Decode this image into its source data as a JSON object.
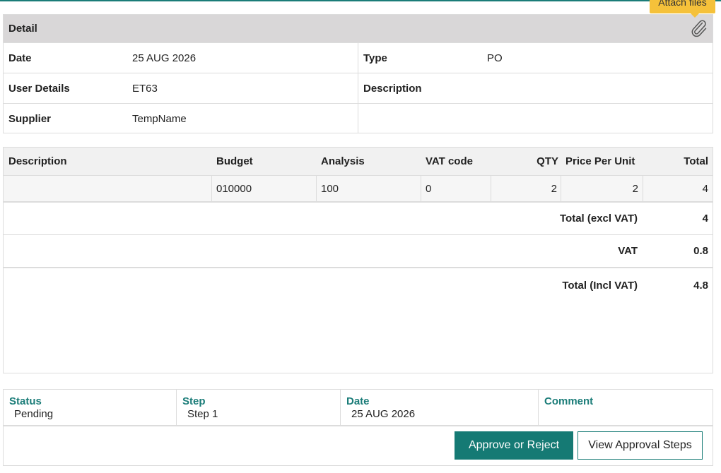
{
  "tooltip": {
    "label": "Attach files"
  },
  "detail": {
    "title": "Detail",
    "attach_icon": "paperclip-icon",
    "date_label": "Date",
    "date_value": "25 AUG 2026",
    "type_label": "Type",
    "type_value": "PO",
    "user_label": "User Details",
    "user_value": "ET63",
    "description_label": "Description",
    "description_value": "",
    "supplier_label": "Supplier",
    "supplier_value": "TempName"
  },
  "items": {
    "columns": [
      "Description",
      "Budget",
      "Analysis",
      "VAT code",
      "QTY",
      "Price Per Unit",
      "Total"
    ],
    "rows": [
      {
        "description": "",
        "budget": "010000",
        "analysis": "100",
        "vat_code": "0",
        "qty": "2",
        "price_per_unit": "2",
        "total": "4"
      }
    ],
    "summary": {
      "excl_label": "Total (excl VAT)",
      "excl_value": "4",
      "vat_label": "VAT",
      "vat_value": "0.8",
      "incl_label": "Total (Incl VAT)",
      "incl_value": "4.8"
    }
  },
  "approval": {
    "status_label": "Status",
    "status_value": "Pending",
    "step_label": "Step",
    "step_value": "Step 1",
    "date_label": "Date",
    "date_value": "25 AUG 2026",
    "comment_label": "Comment",
    "comment_value": "",
    "approve_button": "Approve or Reject",
    "steps_button": "View Approval Steps"
  },
  "colors": {
    "accent": "#157a74",
    "tooltip": "#f5c13a",
    "header_bg": "#d9d7d8"
  }
}
